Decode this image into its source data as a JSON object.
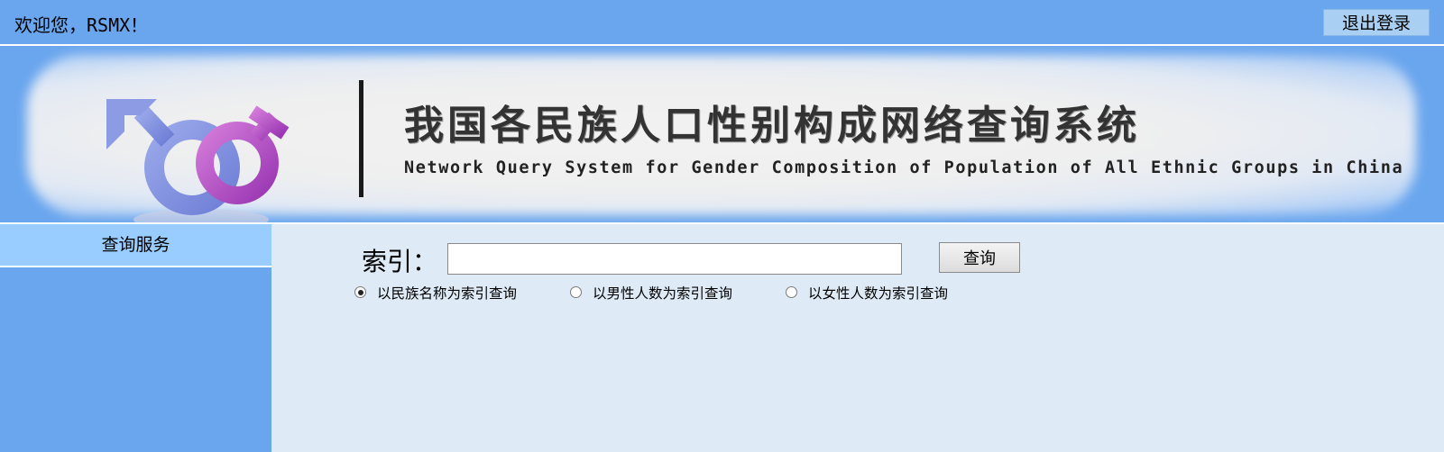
{
  "header": {
    "welcome": "欢迎您，RSMX！",
    "logout_label": "退出登录"
  },
  "banner": {
    "title_cn": "我国各民族人口性别构成网络查询系统",
    "title_en": "Network Query System for Gender Composition of Population of All Ethnic Groups in China",
    "logo_icon": "gender-symbols-logo"
  },
  "sidebar": {
    "items": [
      {
        "label": "查询服务"
      }
    ]
  },
  "search": {
    "label": "索引：",
    "value": "",
    "button_label": "查询",
    "options": [
      {
        "label": "以民族名称为索引查询",
        "checked": true
      },
      {
        "label": "以男性人数为索引查询",
        "checked": false
      },
      {
        "label": "以女性人数为索引查询",
        "checked": false
      }
    ]
  },
  "colors": {
    "primary_blue": "#6aa6ee",
    "main_bg": "#deebf7",
    "sidebar_active": "#99ccff"
  }
}
